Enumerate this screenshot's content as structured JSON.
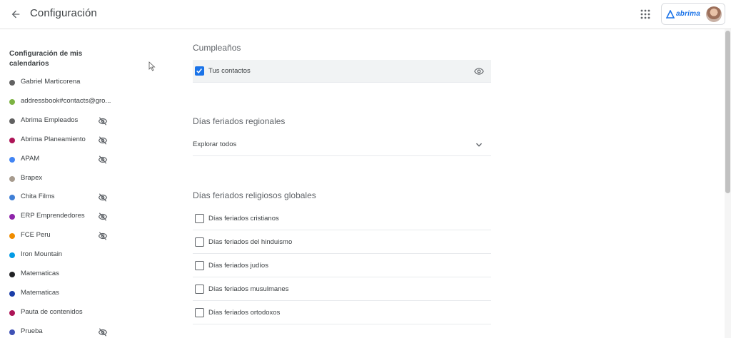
{
  "header": {
    "title": "Configuración",
    "brand_name": "abrima"
  },
  "sidebar": {
    "heading": "Configuración de mis calendarios",
    "items": [
      {
        "label": "Gabriel Marticorena",
        "color": "#616161",
        "hidden": false
      },
      {
        "label": "addressbook#contacts@gro...",
        "color": "#7cb342",
        "hidden": false
      },
      {
        "label": "Abrima Empleados",
        "color": "#616161",
        "hidden": true
      },
      {
        "label": "Abrima Planeamiento",
        "color": "#ad1457",
        "hidden": true
      },
      {
        "label": "APAM",
        "color": "#4285f4",
        "hidden": true
      },
      {
        "label": "Brapex",
        "color": "#a79b8e",
        "hidden": false
      },
      {
        "label": "Chita Films",
        "color": "#3f7fd6",
        "hidden": true
      },
      {
        "label": "ERP Emprendedores",
        "color": "#8e24aa",
        "hidden": true
      },
      {
        "label": "FCE Peru",
        "color": "#ef8c00",
        "hidden": true
      },
      {
        "label": "Iron Mountain",
        "color": "#039be5",
        "hidden": false
      },
      {
        "label": "Matematicas",
        "color": "#202124",
        "hidden": false
      },
      {
        "label": "Matematicas",
        "color": "#1a3da8",
        "hidden": false
      },
      {
        "label": "Pauta de contenidos",
        "color": "#ad1457",
        "hidden": false
      },
      {
        "label": "Prueba",
        "color": "#3f51b5",
        "hidden": true
      }
    ]
  },
  "main": {
    "birthdays": {
      "title": "Cumpleaños",
      "contacts_label": "Tus contactos",
      "contacts_checked": true
    },
    "regional": {
      "title": "Días feriados regionales",
      "explore_label": "Explorar todos"
    },
    "religious": {
      "title": "Días feriados religiosos globales",
      "items": [
        {
          "label": "Días feriados cristianos",
          "checked": false
        },
        {
          "label": "Días feriados del hinduismo",
          "checked": false
        },
        {
          "label": "Días feriados judíos",
          "checked": false
        },
        {
          "label": "Días feriados musulmanes",
          "checked": false
        },
        {
          "label": "Días feriados ortodoxos",
          "checked": false
        }
      ]
    }
  },
  "icons": {
    "back": "arrow-back-icon",
    "apps": "apps-grid-icon",
    "visibility": "eye-icon",
    "hidden": "eye-off-icon",
    "expand": "chevron-down-icon",
    "check": "check-icon"
  },
  "colors": {
    "accent": "#1a73e8"
  }
}
